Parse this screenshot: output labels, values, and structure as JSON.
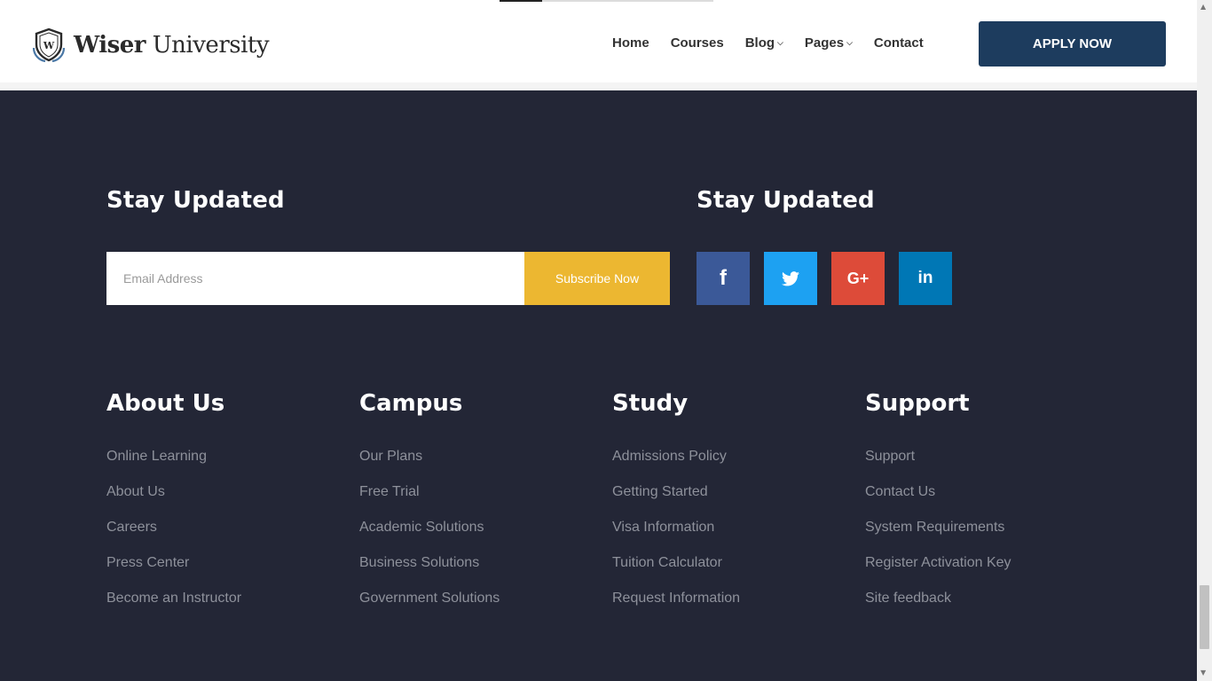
{
  "header": {
    "logo": {
      "bold": "Wiser",
      "regular": "University",
      "emblem_letter": "W"
    },
    "nav": [
      {
        "label": "Home",
        "has_dropdown": false
      },
      {
        "label": "Courses",
        "has_dropdown": false
      },
      {
        "label": "Blog",
        "has_dropdown": true
      },
      {
        "label": "Pages",
        "has_dropdown": true
      },
      {
        "label": "Contact",
        "has_dropdown": false
      }
    ],
    "apply_label": "APPLY NOW"
  },
  "newsletter": {
    "title": "Stay Updated",
    "email_placeholder": "Email Address",
    "subscribe_label": "Subscribe Now"
  },
  "social": {
    "title": "Stay Updated",
    "links": [
      {
        "name": "facebook",
        "glyph": "f",
        "color": "#3b5998"
      },
      {
        "name": "twitter",
        "glyph": "twitter-bird",
        "color": "#1da1f2"
      },
      {
        "name": "google-plus",
        "glyph": "G+",
        "color": "#dd4b39"
      },
      {
        "name": "linkedin",
        "glyph": "in",
        "color": "#0077b5"
      }
    ]
  },
  "footer_columns": [
    {
      "title": "About Us",
      "items": [
        "Online Learning",
        "About Us",
        "Careers",
        "Press Center",
        "Become an Instructor"
      ]
    },
    {
      "title": "Campus",
      "items": [
        "Our Plans",
        "Free Trial",
        "Academic Solutions",
        "Business Solutions",
        "Government Solutions"
      ]
    },
    {
      "title": "Study",
      "items": [
        "Admissions Policy",
        "Getting Started",
        "Visa Information",
        "Tuition Calculator",
        "Request Information"
      ]
    },
    {
      "title": "Support",
      "items": [
        "Support",
        "Contact Us",
        "System Requirements",
        "Register Activation Key",
        "Site feedback"
      ]
    }
  ],
  "colors": {
    "footer_bg": "#232636",
    "apply_button": "#1d3c5e",
    "subscribe_button": "#ecb731",
    "link_text": "#8e919b"
  }
}
